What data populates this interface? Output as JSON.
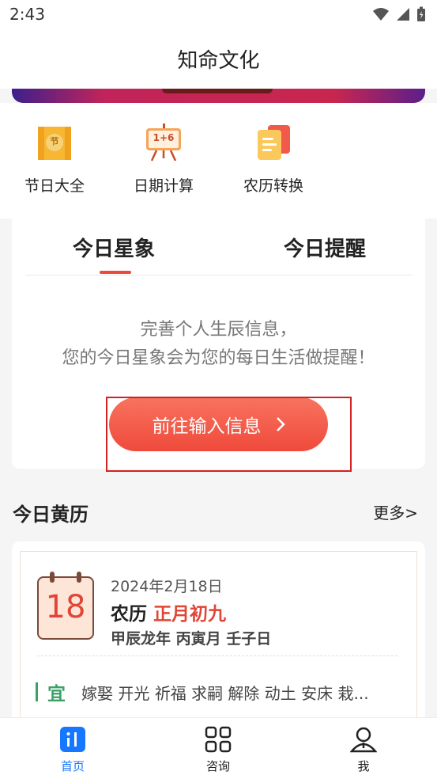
{
  "status": {
    "time": "2:43",
    "icons": [
      "wifi-icon",
      "signal-icon",
      "battery-icon"
    ]
  },
  "header": {
    "title": "知命文化"
  },
  "tools": [
    {
      "label": "节日大全",
      "icon": "festival-icon",
      "icon_text": "节"
    },
    {
      "label": "日期计算",
      "icon": "date-calc-icon",
      "icon_text": "1+6"
    },
    {
      "label": "农历转换",
      "icon": "lunar-convert-icon"
    }
  ],
  "horoscope_card": {
    "tabs": [
      "今日星象",
      "今日提醒"
    ],
    "active_tab": 0,
    "message_line1": "完善个人生辰信息，",
    "message_line2": "您的今日星象会为您的每日生活做提醒！",
    "button_label": "前往输入信息"
  },
  "almanac": {
    "section_title": "今日黄历",
    "more_label": "更多>",
    "day": "18",
    "date": "2024年2月18日",
    "lunar_prefix": "农历",
    "lunar_date": "正月初九",
    "ganzhi": "甲辰龙年 丙寅月 壬子日",
    "yi_label": "宜",
    "yi_items": "嫁娶 开光 祈福 求嗣 解除 动土 安床 栽..."
  },
  "bottom_nav": [
    {
      "label": "首页",
      "icon": "home-icon",
      "active": true
    },
    {
      "label": "咨询",
      "icon": "consult-grid-icon",
      "active": false
    },
    {
      "label": "我",
      "icon": "profile-icon",
      "active": false
    }
  ],
  "colors": {
    "accent": "#ef4a3b",
    "active_nav": "#1677ff",
    "yi_green": "#3aa066"
  }
}
